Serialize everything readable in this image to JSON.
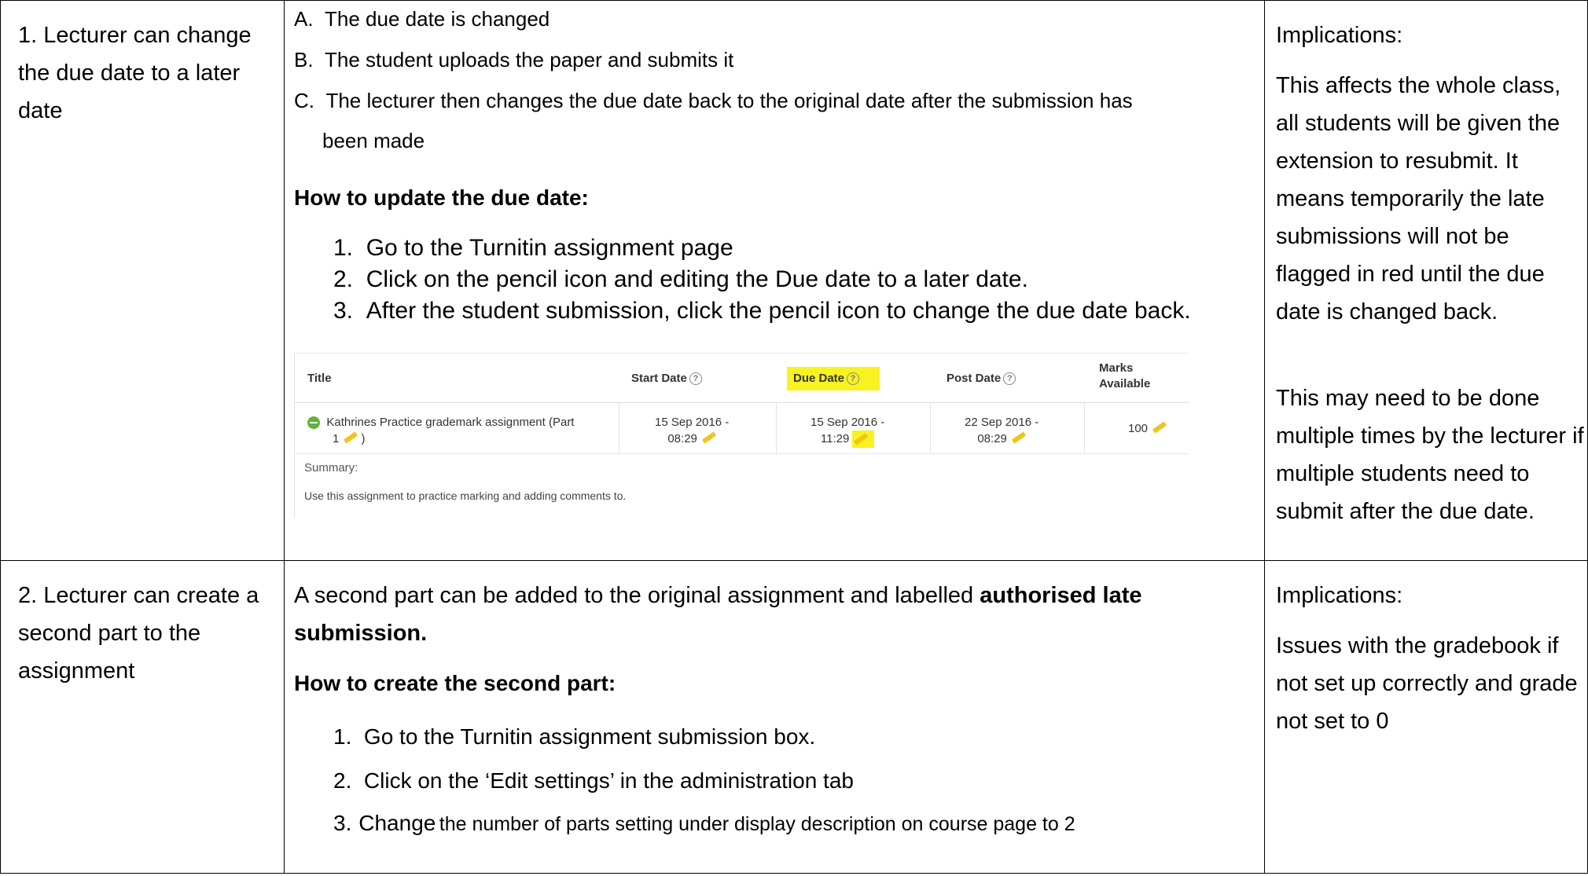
{
  "row1": {
    "scenario": "1. Lecturer can change the due date to a later date",
    "steps_lettered": [
      {
        "letter": "A.",
        "text": "The due date is changed"
      },
      {
        "letter": "B.",
        "text": "The student uploads the paper and submits it"
      },
      {
        "letter": "C.",
        "text": "The lecturer then changes the due date back to the original date after the submission has",
        "cont": "been made"
      }
    ],
    "howto_heading": "How to update the due date:",
    "howto_steps": [
      {
        "num": "1.",
        "text": "Go to the Turnitin assignment page"
      },
      {
        "num": "2.",
        "text": "Click on the pencil icon and editing the Due date to a later date."
      },
      {
        "num": "3.",
        "text": "After the student submission, click the pencil icon to change the due date back."
      }
    ],
    "screenshot": {
      "headers": {
        "title": "Title",
        "start": "Start Date",
        "due": "Due Date",
        "post": "Post Date",
        "marks_line1": "Marks",
        "marks_line2": "Available"
      },
      "row": {
        "title_line1": "Kathrines Practice grademark assignment (Part",
        "title_line2": "1",
        "title_line2_end": ")",
        "start_line1": "15 Sep 2016 -",
        "start_line2": "08:29",
        "due_line1": "15 Sep 2016 -",
        "due_line2": "11:29",
        "post_line1": "22 Sep 2016 -",
        "post_line2": "08:29",
        "marks": "100"
      },
      "summary_label": "Summary:",
      "summary_text": "Use this assignment to practice marking and adding comments to.",
      "highlight_color": "#f7f220",
      "status_color": "#5fb336",
      "pencil_color": "#f0c419"
    },
    "implications_label": "Implications:",
    "implications_p1": "This affects the whole class, all students will be given the extension to resubmit. It means temporarily the late submissions will not be flagged in red until the due date is changed back.",
    "implications_p2": "This may need to be done multiple times by the lecturer if multiple students need to submit after the due date."
  },
  "row2": {
    "scenario": "2. Lecturer can create a second part to the assignment",
    "intro_text": "A second part can be added to the original assignment and labelled ",
    "intro_bold_1": "authorised late",
    "intro_bold_2": "submission.",
    "howto_heading": "How to create the second part:",
    "howto_steps": [
      {
        "num": "1.",
        "text": "Go to the Turnitin assignment submission box."
      },
      {
        "num": "2.",
        "text": "Click on the ‘Edit settings’ in the administration tab"
      },
      {
        "num": "3.",
        "text_a": "Change",
        "text_b": "the number of parts setting under display description on course page to 2"
      }
    ],
    "implications_label": "Implications:",
    "implications_p1": "Issues with the gradebook if not set up correctly and grade not set to 0"
  }
}
